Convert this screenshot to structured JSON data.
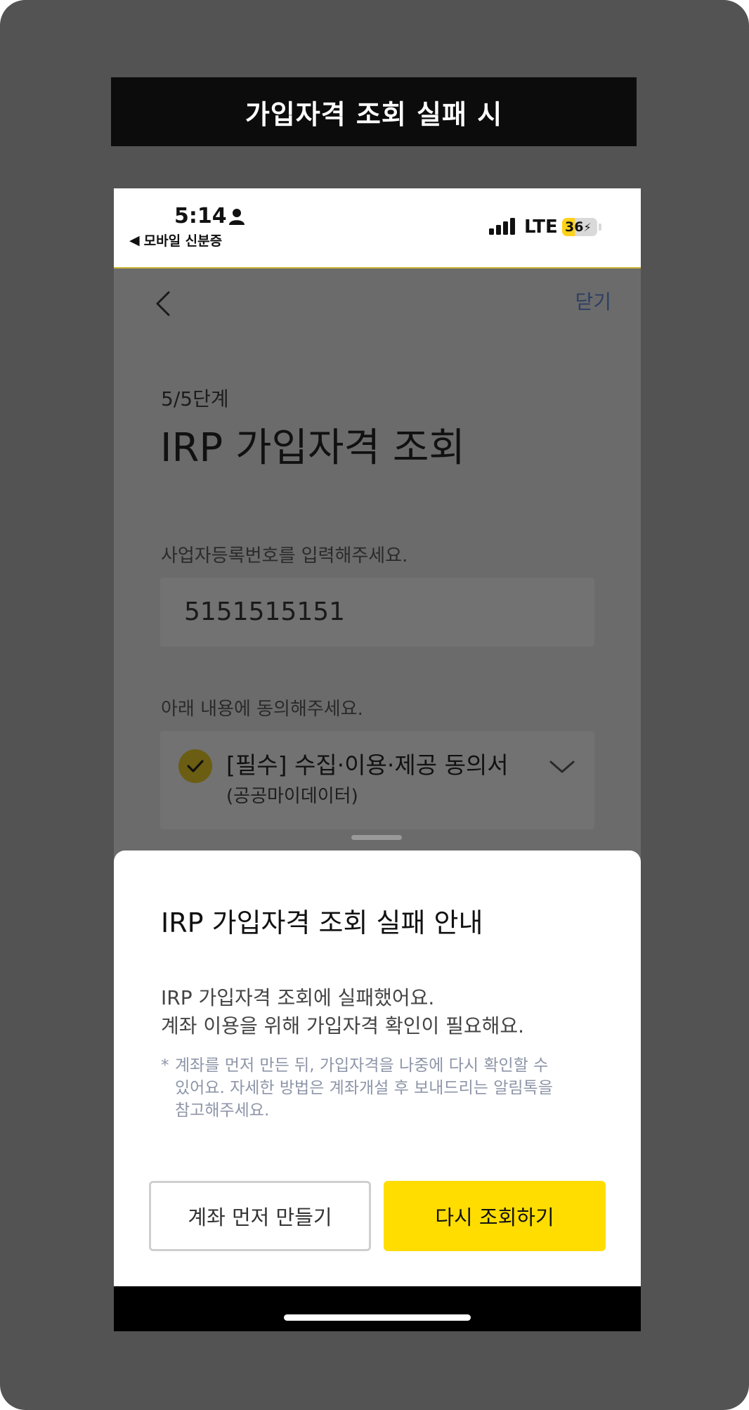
{
  "banner": {
    "title": "가입자격 조회 실패 시"
  },
  "status_bar": {
    "time": "5:14",
    "back_app": "모바일 신분증",
    "network": "LTE",
    "battery_level": "36",
    "battery_fraction": 0.36
  },
  "nav": {
    "close": "닫기"
  },
  "page": {
    "step": "5/5단계",
    "title": "IRP 가입자격 조회",
    "business_number_label": "사업자등록번호를 입력해주세요.",
    "business_number_value": "5151515151",
    "consent_label": "아래 내용에 동의해주세요.",
    "consent_item_title": "[필수] 수집·이용·제공 동의서",
    "consent_item_sub": "(공공마이데이터)"
  },
  "sheet": {
    "title": "IRP 가입자격 조회 실패 안내",
    "line1": "IRP 가입자격 조회에 실패했어요.",
    "line2": "계좌 이용을 위해 가입자격 확인이 필요해요.",
    "note_star": "*",
    "note": "계좌를 먼저 만든 뒤, 가입자격을 나중에 다시 확인할 수 있어요. 자세한 방법은 계좌개설 후 보내드리는 알림톡을 참고해주세요.",
    "secondary_button": "계좌 먼저 만들기",
    "primary_button": "다시 조회하기"
  },
  "colors": {
    "frame": "#535353",
    "banner": "#0c0c0c",
    "primary": "#ffdd00",
    "close_link": "#2c3f62",
    "note_text": "#8d95a8"
  }
}
